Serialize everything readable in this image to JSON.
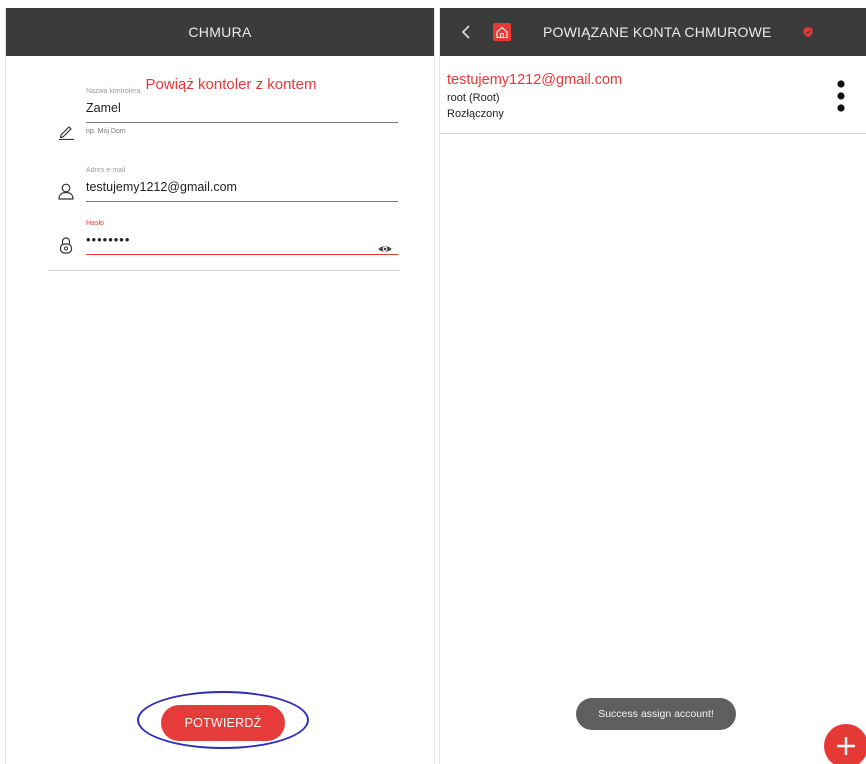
{
  "left": {
    "header_title": "CHMURA",
    "form_title": "Powiąż kontoler z kontem",
    "controller_name": {
      "label": "Nazwa kontrolera",
      "value": "Zamel",
      "hint": "np. Mój Dom"
    },
    "email": {
      "label": "Adres e-mail",
      "value": "testujemy1212@gmail.com"
    },
    "password": {
      "label": "Hasło",
      "value": "••••••••"
    },
    "confirm_label": "POTWIERDŹ"
  },
  "right": {
    "header_title": "POWIĄZANE KONTA CHMUROWE",
    "account": {
      "email": "testujemy1212@gmail.com",
      "user": "root (Root)",
      "status": "Rozłączony"
    },
    "toast": "Success assign account!"
  },
  "icons": {
    "edit": "pencil-icon",
    "user": "person-icon",
    "lock": "lock-icon",
    "eye": "eye-icon",
    "back": "chevron-left-icon",
    "home": "home-icon",
    "shield": "shield-icon",
    "more": "more-vertical-icon",
    "add": "plus-icon"
  },
  "colors": {
    "header_bg": "#3b3b3b",
    "accent": "#e53935",
    "highlight": "#2d2db9",
    "toast_bg": "#5f5f5f"
  }
}
